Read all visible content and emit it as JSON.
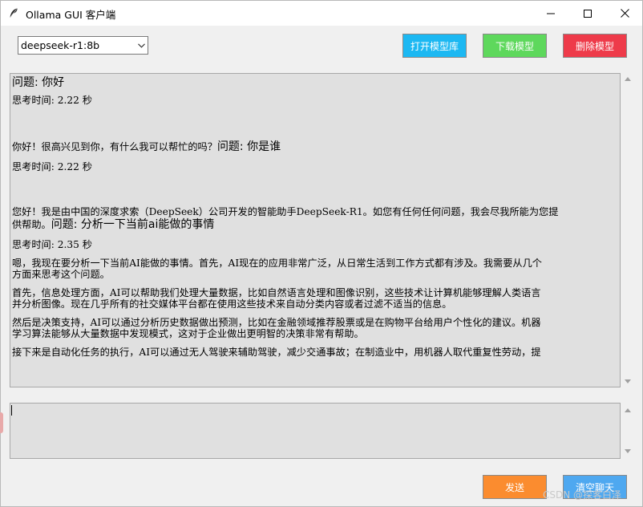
{
  "window": {
    "title": "Ollama GUI 客户端"
  },
  "toolbar": {
    "model_select": "deepseek-r1:8b",
    "open_library_label": "打开模型库",
    "download_label": "下载模型",
    "delete_label": "删除模型"
  },
  "chat": {
    "q1": "问题: 你好",
    "t1": "思考时间: 2.22 秒",
    "a1_with_q2_prefix": "你好！很高兴见到你，有什么我可以帮忙的吗？",
    "q2": "问题: 你是谁",
    "t2": "思考时间: 2.22 秒",
    "a2_line1": "您好！我是由中国的深度求索（DeepSeek）公司开发的智能助手DeepSeek-R1。如您有任何任何问题，我会尽我所能为您提",
    "a2_line2_prefix": "供帮助。",
    "q3": "问题: 分析一下当前ai能做的事情",
    "t3": "思考时间: 2.35 秒",
    "p1_line1": "嗯，我现在要分析一下当前AI能做的事情。首先，AI现在的应用非常广泛，从日常生活到工作方式都有涉及。我需要从几个",
    "p1_line2": "方面来思考这个问题。",
    "p2_line1": "首先，信息处理方面，AI可以帮助我们处理大量数据，比如自然语言处理和图像识别，这些技术让计算机能够理解人类语言",
    "p2_line2": "并分析图像。现在几乎所有的社交媒体平台都在使用这些技术来自动分类内容或者过滤不适当的信息。",
    "p3_line1": "然后是决策支持，AI可以通过分析历史数据做出预测，比如在金融领域推荐股票或是在购物平台给用户个性化的建议。机器",
    "p3_line2": "学习算法能够从大量数据中发现模式，这对于企业做出更明智的决策非常有帮助。",
    "p4_line1": "接下来是自动化任务的执行，AI可以通过无人驾驶来辅助驾驶，减少交通事故；在制造业中，用机器人取代重复性劳动，提"
  },
  "actions": {
    "send_label": "发送",
    "clear_label": "清空聊天"
  },
  "watermark": "CSDN @探客白泽",
  "colors": {
    "open_btn": "#1cb8f2",
    "download_btn": "#5ed85c",
    "delete_btn": "#ee3b4a",
    "send_btn": "#fb8c2f",
    "clear_btn": "#4ea8f0"
  }
}
